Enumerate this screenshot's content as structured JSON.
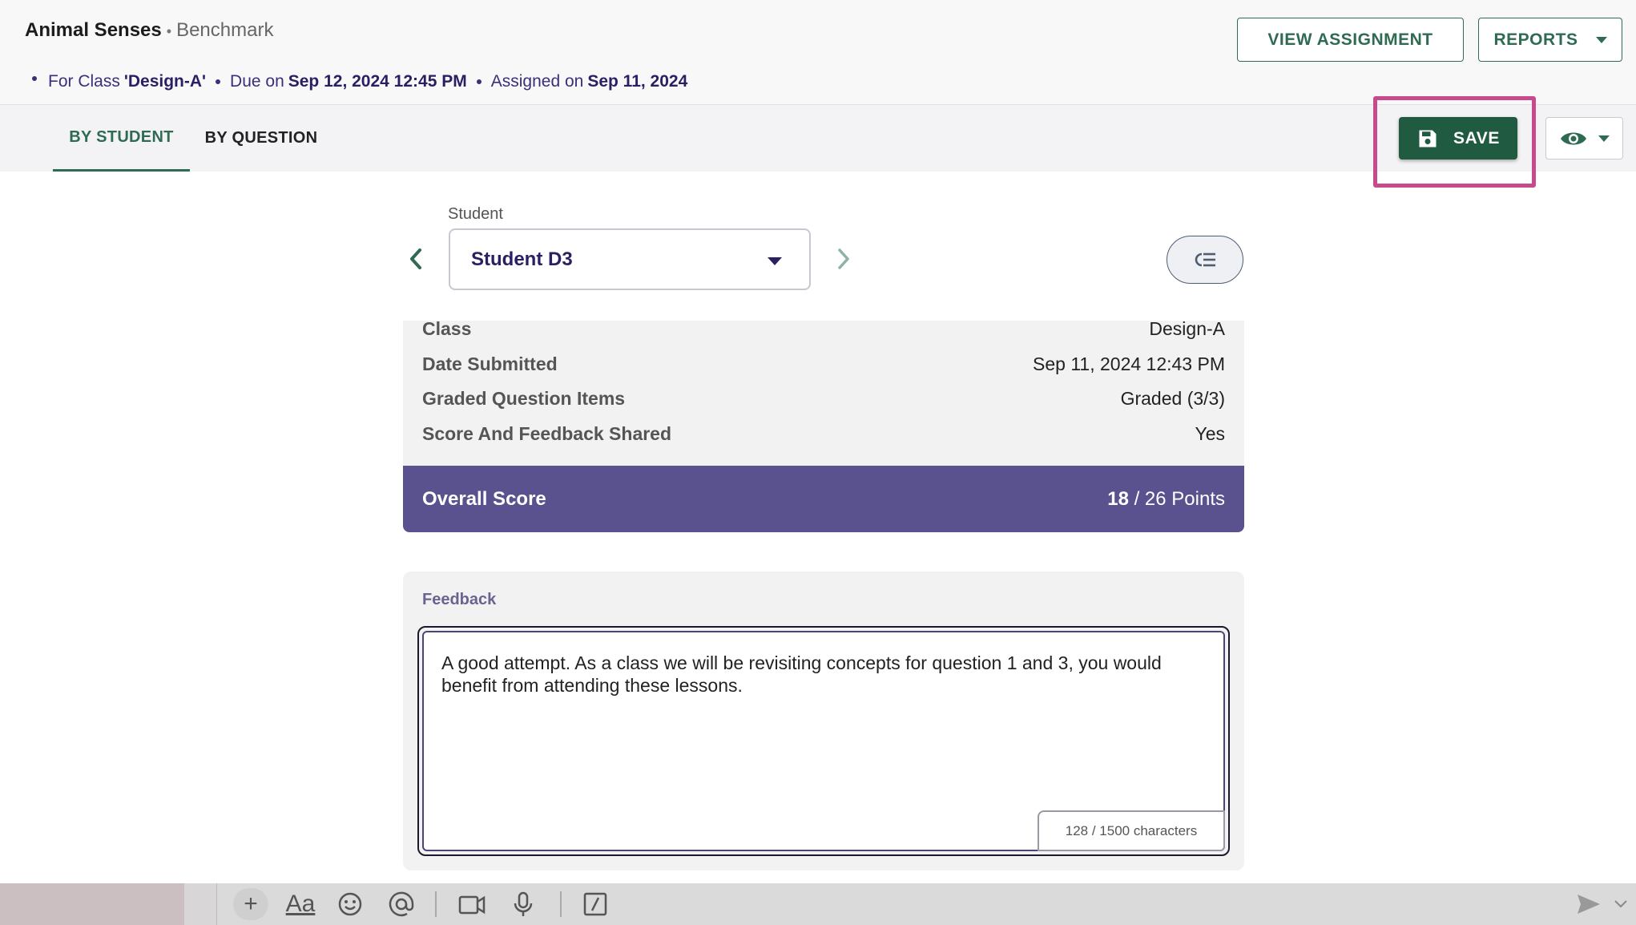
{
  "header": {
    "app_title": "Animal Senses",
    "separator": "•",
    "assessment_type": "Benchmark",
    "meta": {
      "class_prefix": "For Class",
      "class_value": "'Design-A'",
      "due_prefix": "Due on",
      "due_value": "Sep 12, 2024 12:45 PM",
      "assigned_prefix": "Assigned on",
      "assigned_value": "Sep 11, 2024"
    },
    "view_assignment_label": "VIEW ASSIGNMENT",
    "reports_label": "REPORTS"
  },
  "tabs": [
    {
      "label": "BY STUDENT",
      "active": true
    },
    {
      "label": "BY QUESTION",
      "active": false
    }
  ],
  "toolbar": {
    "save_label": "SAVE",
    "save_icon": "floppy-disk-icon",
    "view_icon": "eye-icon"
  },
  "student_selector": {
    "label": "Student",
    "selected": "Student D3"
  },
  "info": {
    "rows": [
      {
        "key": "Class",
        "value": "Design-A"
      },
      {
        "key": "Date Submitted",
        "value": "Sep 11, 2024 12:43 PM"
      },
      {
        "key": "Graded Question Items",
        "value": "Graded (3/3)"
      },
      {
        "key": "Score And Feedback Shared",
        "value": "Yes"
      }
    ],
    "overall_label": "Overall Score",
    "overall_score": "18",
    "overall_total": "/ 26 Points"
  },
  "feedback": {
    "label": "Feedback",
    "text": "A good attempt. As a class we will be revisiting concepts for question 1 and 3, you would benefit from attending these lessons.",
    "char_count": "128 / 1500 characters"
  },
  "chatbar": {
    "plus": "+",
    "format": "Aa"
  },
  "colors": {
    "primary_green": "#1f5a41",
    "accent_purple": "#5a528f",
    "highlight_pink": "#c94a8c"
  }
}
